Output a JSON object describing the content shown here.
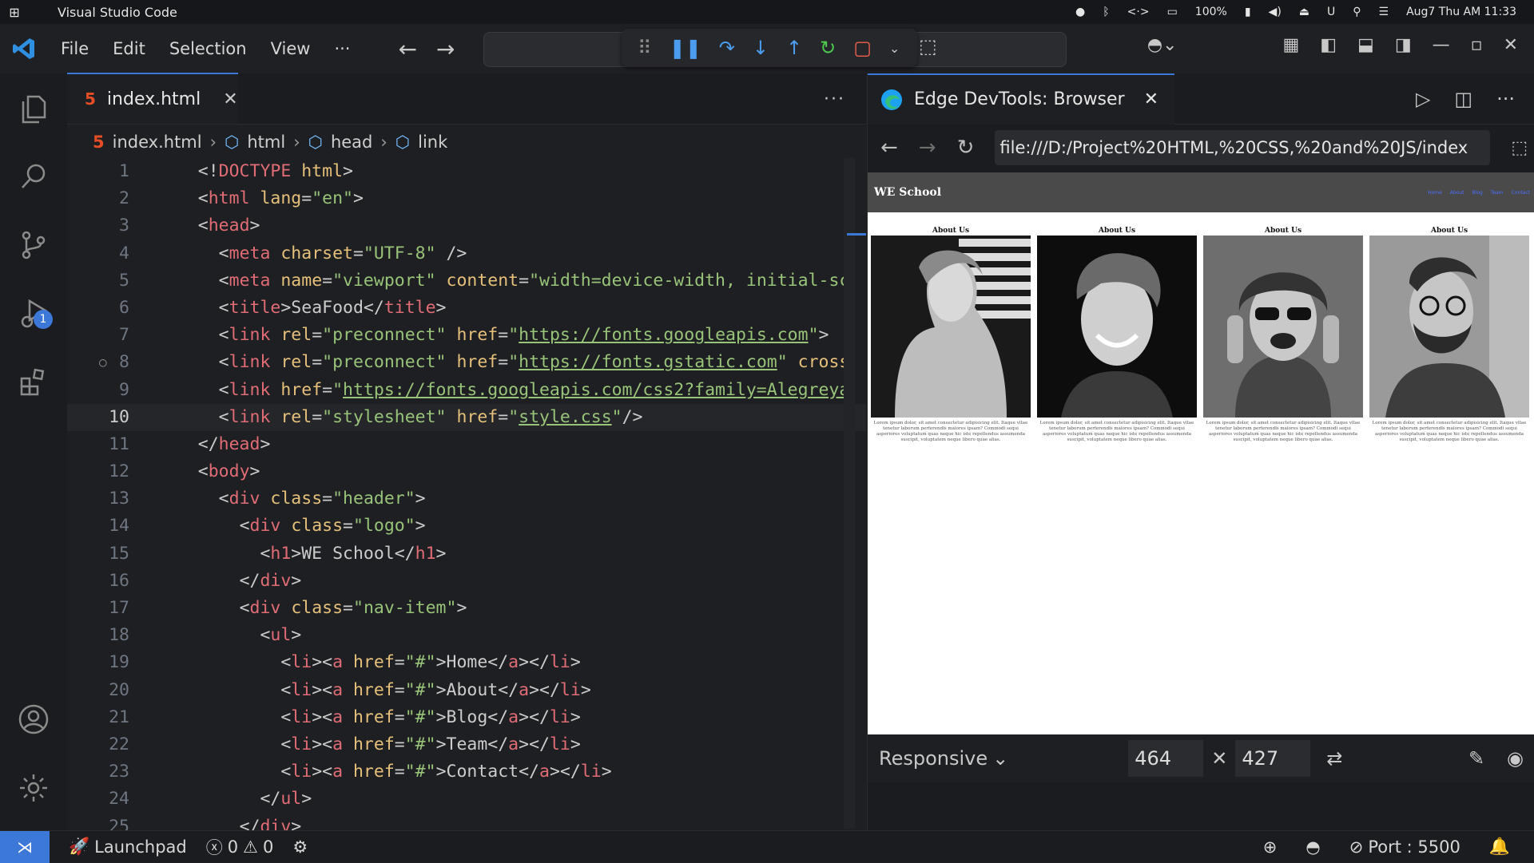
{
  "os": {
    "app_name": "Visual Studio Code",
    "battery": "100%",
    "datetime": "Aug7 Thu AM 11:33"
  },
  "menu": [
    "File",
    "Edit",
    "Selection",
    "View",
    "···"
  ],
  "editor": {
    "tab_label": "index.html",
    "breadcrumb": [
      "index.html",
      "html",
      "head",
      "link"
    ],
    "current_line": 10,
    "lines": [
      {
        "n": "1",
        "html": "<span class='p'>&lt;!</span><span class='t'>DOCTYPE</span><span class='a'> html</span><span class='p'>&gt;</span>"
      },
      {
        "n": "2",
        "html": "<span class='p'>&lt;</span><span class='t'>html</span> <span class='a'>lang</span><span class='p'>=</span><span class='s'>\"en\"</span><span class='p'>&gt;</span>"
      },
      {
        "n": "3",
        "html": "<span class='p'>&lt;</span><span class='t'>head</span><span class='p'>&gt;</span>"
      },
      {
        "n": "4",
        "html": "  <span class='p'>&lt;</span><span class='t'>meta</span> <span class='a'>charset</span><span class='p'>=</span><span class='s'>\"UTF-8\"</span> <span class='p'>/&gt;</span>"
      },
      {
        "n": "5",
        "html": "  <span class='p'>&lt;</span><span class='t'>meta</span> <span class='a'>name</span><span class='p'>=</span><span class='s'>\"viewport\"</span> <span class='a'>content</span><span class='p'>=</span><span class='s'>\"width=device-width, initial-sc</span>"
      },
      {
        "n": "6",
        "html": "  <span class='p'>&lt;</span><span class='t'>title</span><span class='p'>&gt;SeaFood&lt;/</span><span class='t'>title</span><span class='p'>&gt;</span>"
      },
      {
        "n": "7",
        "html": "  <span class='p'>&lt;</span><span class='t'>link</span> <span class='a'>rel</span><span class='p'>=</span><span class='s'>\"preconnect\"</span> <span class='a'>href</span><span class='p'>=</span><span class='s'>\"</span><span class='u'>https://fonts.googleapis.com</span><span class='s'>\"</span><span class='p'>&gt;</span>"
      },
      {
        "n": "8",
        "html": "  <span class='p'>&lt;</span><span class='t'>link</span> <span class='a'>rel</span><span class='p'>=</span><span class='s'>\"preconnect\"</span> <span class='a'>href</span><span class='p'>=</span><span class='s'>\"</span><span class='u'>https://fonts.gstatic.com</span><span class='s'>\"</span> <span class='a'>cross</span>"
      },
      {
        "n": "9",
        "html": "  <span class='p'>&lt;</span><span class='t'>link</span> <span class='a'>href</span><span class='p'>=</span><span class='s'>\"</span><span class='u'>https://fonts.googleapis.com/css2?family=Alegreya</span>"
      },
      {
        "n": "10",
        "html": "  <span class='p'>&lt;</span><span class='t'>link</span> <span class='a'>rel</span><span class='p'>=</span><span class='s'>\"stylesheet\"</span> <span class='a'>href</span><span class='p'>=</span><span class='s'>\"</span><span class='u'>style.css</span><span class='s'>\"</span><span class='p'>/&gt;</span>"
      },
      {
        "n": "11",
        "html": "<span class='p'>&lt;/</span><span class='t'>head</span><span class='p'>&gt;</span>"
      },
      {
        "n": "12",
        "html": "<span class='p'>&lt;</span><span class='t'>body</span><span class='p'>&gt;</span>"
      },
      {
        "n": "13",
        "html": "  <span class='p'>&lt;</span><span class='t'>div</span> <span class='a'>class</span><span class='p'>=</span><span class='s'>\"header\"</span><span class='p'>&gt;</span>"
      },
      {
        "n": "14",
        "html": "    <span class='p'>&lt;</span><span class='t'>div</span> <span class='a'>class</span><span class='p'>=</span><span class='s'>\"logo\"</span><span class='p'>&gt;</span>"
      },
      {
        "n": "15",
        "html": "      <span class='p'>&lt;</span><span class='t'>h1</span><span class='p'>&gt;WE School&lt;/</span><span class='t'>h1</span><span class='p'>&gt;</span>"
      },
      {
        "n": "16",
        "html": "    <span class='p'>&lt;/</span><span class='t'>div</span><span class='p'>&gt;</span>"
      },
      {
        "n": "17",
        "html": "    <span class='p'>&lt;</span><span class='t'>div</span> <span class='a'>class</span><span class='p'>=</span><span class='s'>\"nav-item\"</span><span class='p'>&gt;</span>"
      },
      {
        "n": "18",
        "html": "      <span class='p'>&lt;</span><span class='t'>ul</span><span class='p'>&gt;</span>"
      },
      {
        "n": "19",
        "html": "        <span class='p'>&lt;</span><span class='t'>li</span><span class='p'>&gt;&lt;</span><span class='t'>a</span> <span class='a'>href</span><span class='p'>=</span><span class='s'>\"#\"</span><span class='p'>&gt;Home&lt;/</span><span class='t'>a</span><span class='p'>&gt;&lt;/</span><span class='t'>li</span><span class='p'>&gt;</span>"
      },
      {
        "n": "20",
        "html": "        <span class='p'>&lt;</span><span class='t'>li</span><span class='p'>&gt;&lt;</span><span class='t'>a</span> <span class='a'>href</span><span class='p'>=</span><span class='s'>\"#\"</span><span class='p'>&gt;About&lt;/</span><span class='t'>a</span><span class='p'>&gt;&lt;/</span><span class='t'>li</span><span class='p'>&gt;</span>"
      },
      {
        "n": "21",
        "html": "        <span class='p'>&lt;</span><span class='t'>li</span><span class='p'>&gt;&lt;</span><span class='t'>a</span> <span class='a'>href</span><span class='p'>=</span><span class='s'>\"#\"</span><span class='p'>&gt;Blog&lt;/</span><span class='t'>a</span><span class='p'>&gt;&lt;/</span><span class='t'>li</span><span class='p'>&gt;</span>"
      },
      {
        "n": "22",
        "html": "        <span class='p'>&lt;</span><span class='t'>li</span><span class='p'>&gt;&lt;</span><span class='t'>a</span> <span class='a'>href</span><span class='p'>=</span><span class='s'>\"#\"</span><span class='p'>&gt;Team&lt;/</span><span class='t'>a</span><span class='p'>&gt;&lt;/</span><span class='t'>li</span><span class='p'>&gt;</span>"
      },
      {
        "n": "23",
        "html": "        <span class='p'>&lt;</span><span class='t'>li</span><span class='p'>&gt;&lt;</span><span class='t'>a</span> <span class='a'>href</span><span class='p'>=</span><span class='s'>\"#\"</span><span class='p'>&gt;Contact&lt;/</span><span class='t'>a</span><span class='p'>&gt;&lt;/</span><span class='t'>li</span><span class='p'>&gt;</span>"
      },
      {
        "n": "24",
        "html": "      <span class='p'>&lt;/</span><span class='t'>ul</span><span class='p'>&gt;</span>"
      },
      {
        "n": "25",
        "html": "    <span class='p'>&lt;/</span><span class='t'>div</span><span class='p'>&gt;</span>"
      }
    ]
  },
  "devtools": {
    "tab_label": "Edge DevTools: Browser",
    "url": "file:///D:/Project%20HTML,%20CSS,%20and%20JS/index",
    "device_mode": "Responsive",
    "width": "464",
    "height": "427",
    "site": {
      "logo": "WE School",
      "nav": [
        "Home",
        "About",
        "Blog",
        "Team",
        "Contact"
      ],
      "cards": [
        {
          "title": "About Us"
        },
        {
          "title": "About Us"
        },
        {
          "title": "About Us"
        },
        {
          "title": "About Us"
        }
      ],
      "lorem": "Lorem ipsum dolor, sit amet consectetur adipisicing elit. Itaque vitae tenetur laborum perferendis maiores ipsam? Commodi sequi asperiores voluptatum quas neque hic iste repellendus assumenda suscipit, voluptatem neque libero quae alias."
    }
  },
  "statusbar": {
    "launchpad": "Launchpad",
    "errors": "0",
    "warnings": "0",
    "port": "Port : 5500"
  },
  "colors": {
    "accent": "#3c78d8",
    "background": "#1e1f22"
  }
}
